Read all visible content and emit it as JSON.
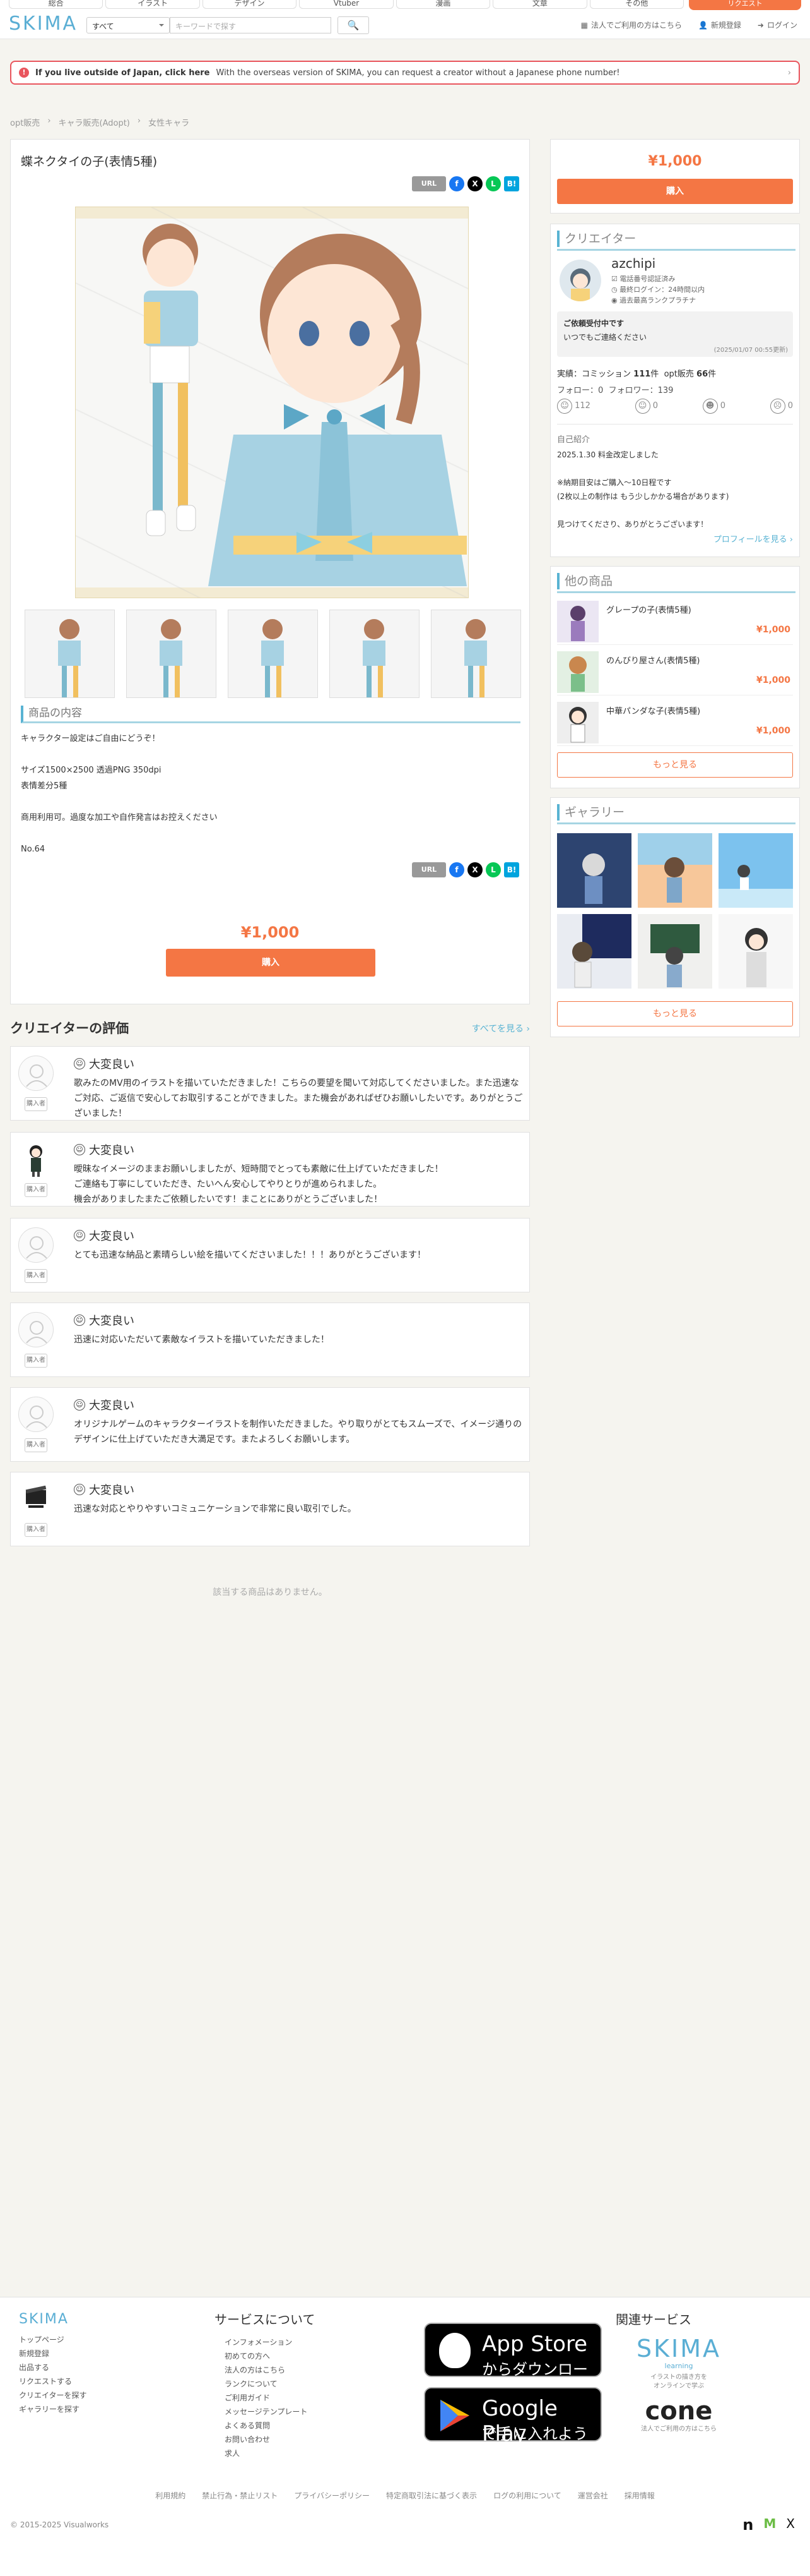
{
  "header": {
    "categories": [
      "総合",
      "イラスト",
      "デザイン",
      "Vtuber",
      "漫画",
      "文章",
      "その他"
    ],
    "cta_label": "リクエスト",
    "logo_text": "SKIMA",
    "search": {
      "category_value": "すべて",
      "placeholder": "キーワードで探す"
    },
    "links": [
      "法人でご利用の方はこちら",
      "新規登録",
      "ログイン"
    ]
  },
  "banner": {
    "title": "If you live outside of Japan, click here",
    "text": "With the overseas version of SKIMA, you can request a creator without a Japanese phone number!"
  },
  "breadcrumb": [
    "opt販売",
    "キャラ販売(Adopt)",
    "女性キャラ"
  ],
  "product": {
    "title": "蝶ネクタイの子(表情5種)",
    "share": {
      "url_label": "URL",
      "f": "f",
      "x": "X",
      "line": "L",
      "hatena": "B!"
    },
    "section_title": "商品の内容",
    "description": "キャラクター設定はご自由にどうぞ！\n\nサイズ1500×2500 透過PNG 350dpi\n表情差分5種\n\n商用利用可。過度な加工や自作発言はお控えください\n\nNo.64",
    "price": "¥1,000",
    "buy_label": "購入"
  },
  "sidebar": {
    "price": "¥1,000",
    "buy_label": "購入",
    "creator_section": "クリエイター",
    "creator": {
      "name": "azchipi",
      "verified": "電話番号認証済み",
      "last_login": "最終ログイン：24時間以内",
      "rank": "過去最高ランクプラチナ",
      "status_title": "ご依頼受付中です",
      "status_text": "いつでもご連絡ください",
      "status_date": "(2025/01/07 00:55更新)",
      "stats_line": "実績：コミッション",
      "commission_count": "111",
      "unit": "件",
      "opt_label": "opt販売",
      "opt_count": "66",
      "follow_label": "フォロー：",
      "follow": "0",
      "follower_label": "フォロワー：",
      "follower": "139",
      "ratings": [
        "112",
        "0",
        "0",
        "0"
      ],
      "intro_label": "自己紹介",
      "intro": "2025.1.30 料金改定しました\n\n※納期目安はご購入〜10日程です\n(2枚以上の制作は もう少しかかる場合があります)\n\n見つけてくださり、ありがとうございます！",
      "profile_link": "プロフィールを見る ›"
    },
    "other_section": "他の商品",
    "other_items": [
      {
        "name": "グレープの子(表情5種)",
        "price": "¥1,000"
      },
      {
        "name": "のんびり屋さん(表情5種)",
        "price": "¥1,000"
      },
      {
        "name": "中華パンダな子(表情5種)",
        "price": "¥1,000"
      }
    ],
    "more_label": "もっと見る",
    "gallery_section": "ギャラリー",
    "gallery_more_label": "もっと見る"
  },
  "reviews": {
    "title": "クリエイターの評価",
    "see_all": "すべてを見る ›",
    "buyer_badge": "購入者",
    "items": [
      {
        "rating": "大変良い",
        "text": "歌みたのMV用のイラストを描いていただきました！こちらの要望を聞いて対応してくださいました。また迅速なご対応、ご返信で安心してお取引することができました。また機会があればぜひお願いしたいです。ありがとうございました！"
      },
      {
        "rating": "大変良い",
        "text": "曖昧なイメージのままお願いしましたが、短時間でとっても素敵に仕上げていただきました！\nご連絡も丁寧にしていただき、たいへん安心してやりとりが進められました。\n機会がありましたまたご依頼したいです！まことにありがとうございました！"
      },
      {
        "rating": "大変良い",
        "text": "とても迅速な納品と素晴らしい絵を描いてくださいました！！！ありがとうございます！"
      },
      {
        "rating": "大変良い",
        "text": "迅速に対応いただいて素敵なイラストを描いていただきました！"
      },
      {
        "rating": "大変良い",
        "text": "オリジナルゲームのキャラクターイラストを制作いただきました。やり取りがとてもスムーズで、イメージ通りのデザインに仕上げていただき大満足です。またよろしくお願いします。"
      },
      {
        "rating": "大変良い",
        "text": "迅速な対応とやりやすいコミュニケーションで非常に良い取引でした。"
      }
    ]
  },
  "related_empty": "該当する商品はありません。",
  "footer": {
    "logo_text": "SKIMA",
    "col1": [
      "トップページ",
      "新規登録",
      "出品する",
      "リクエストする",
      "クリエイターを探す",
      "ギャラリーを探す"
    ],
    "service_title": "サービスについて",
    "col2": [
      "インフォメーション",
      "初めての方へ",
      "法人の方はこちら",
      "ランクについて",
      "ご利用ガイド",
      "メッセージテンプレート",
      "よくある質問",
      "お問い合わせ",
      "求人"
    ],
    "appstore": {
      "line1": "App Store",
      "line2": "からダウンロード"
    },
    "googleplay": {
      "line1": "Google Play",
      "line2": "で手に入れよう"
    },
    "related_title": "関連サービス",
    "skima_learning": {
      "name": "SKIMA",
      "sub": "learning",
      "desc1": "イラストの描き方を",
      "desc2": "オンラインで学ぶ"
    },
    "cone": {
      "name": "cone",
      "desc": "法人でご利用の方はこちら"
    },
    "links": [
      "利用規約",
      "禁止行為・禁止リスト",
      "プライバシーポリシー",
      "特定商取引法に基づく表示",
      "ログの利用について",
      "運営会社",
      "採用情報"
    ],
    "copyright": "© 2015-2025 Visualworks"
  }
}
